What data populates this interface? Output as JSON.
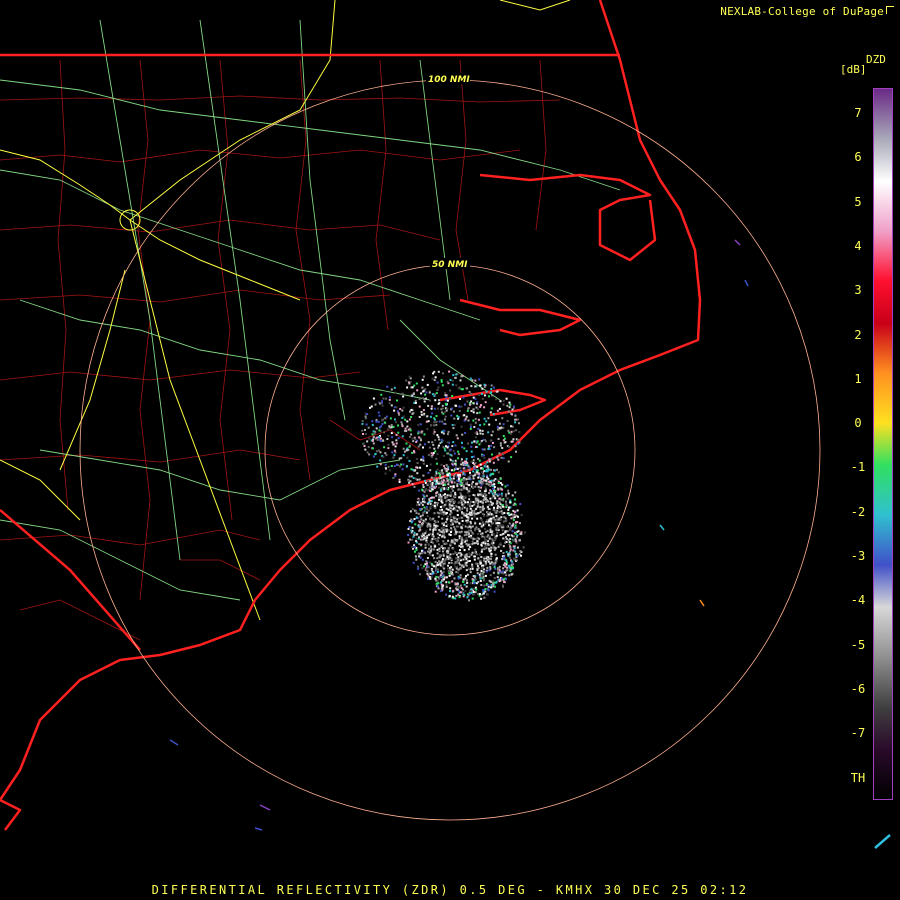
{
  "credit": "NEXLAB-College of DuPage",
  "credit_icon": "external-link-icon",
  "footer": "DIFFERENTIAL REFLECTIVITY (ZDR) 0.5 DEG - KMHX 30 DEC 25 02:12",
  "legend": {
    "product": "DZD",
    "unit": "[dB]",
    "ticks": [
      "7",
      "6",
      "5",
      "4",
      "3",
      "2",
      "1",
      "0",
      "-1",
      "-2",
      "-3",
      "-4",
      "-5",
      "-6",
      "-7",
      "TH"
    ],
    "colors": [
      "#6a2a86",
      "#a8a8b8",
      "#ffffff",
      "#f0a0c8",
      "#ff1030",
      "#c80018",
      "#ff9020",
      "#ffe020",
      "#30e060",
      "#30c0d0",
      "#4050c8",
      "#d8d8d8",
      "#909090",
      "#404040",
      "#2a0a2a",
      "#000000"
    ]
  },
  "range_rings": [
    {
      "label": "100 NMI"
    },
    {
      "label": "50 NMI"
    }
  ],
  "map_colors": {
    "state_border": "#ff2020",
    "county_border": "#c01818",
    "highway_major": "#ffff40",
    "highway_minor": "#90ee90",
    "range_ring": "#ffb090"
  }
}
